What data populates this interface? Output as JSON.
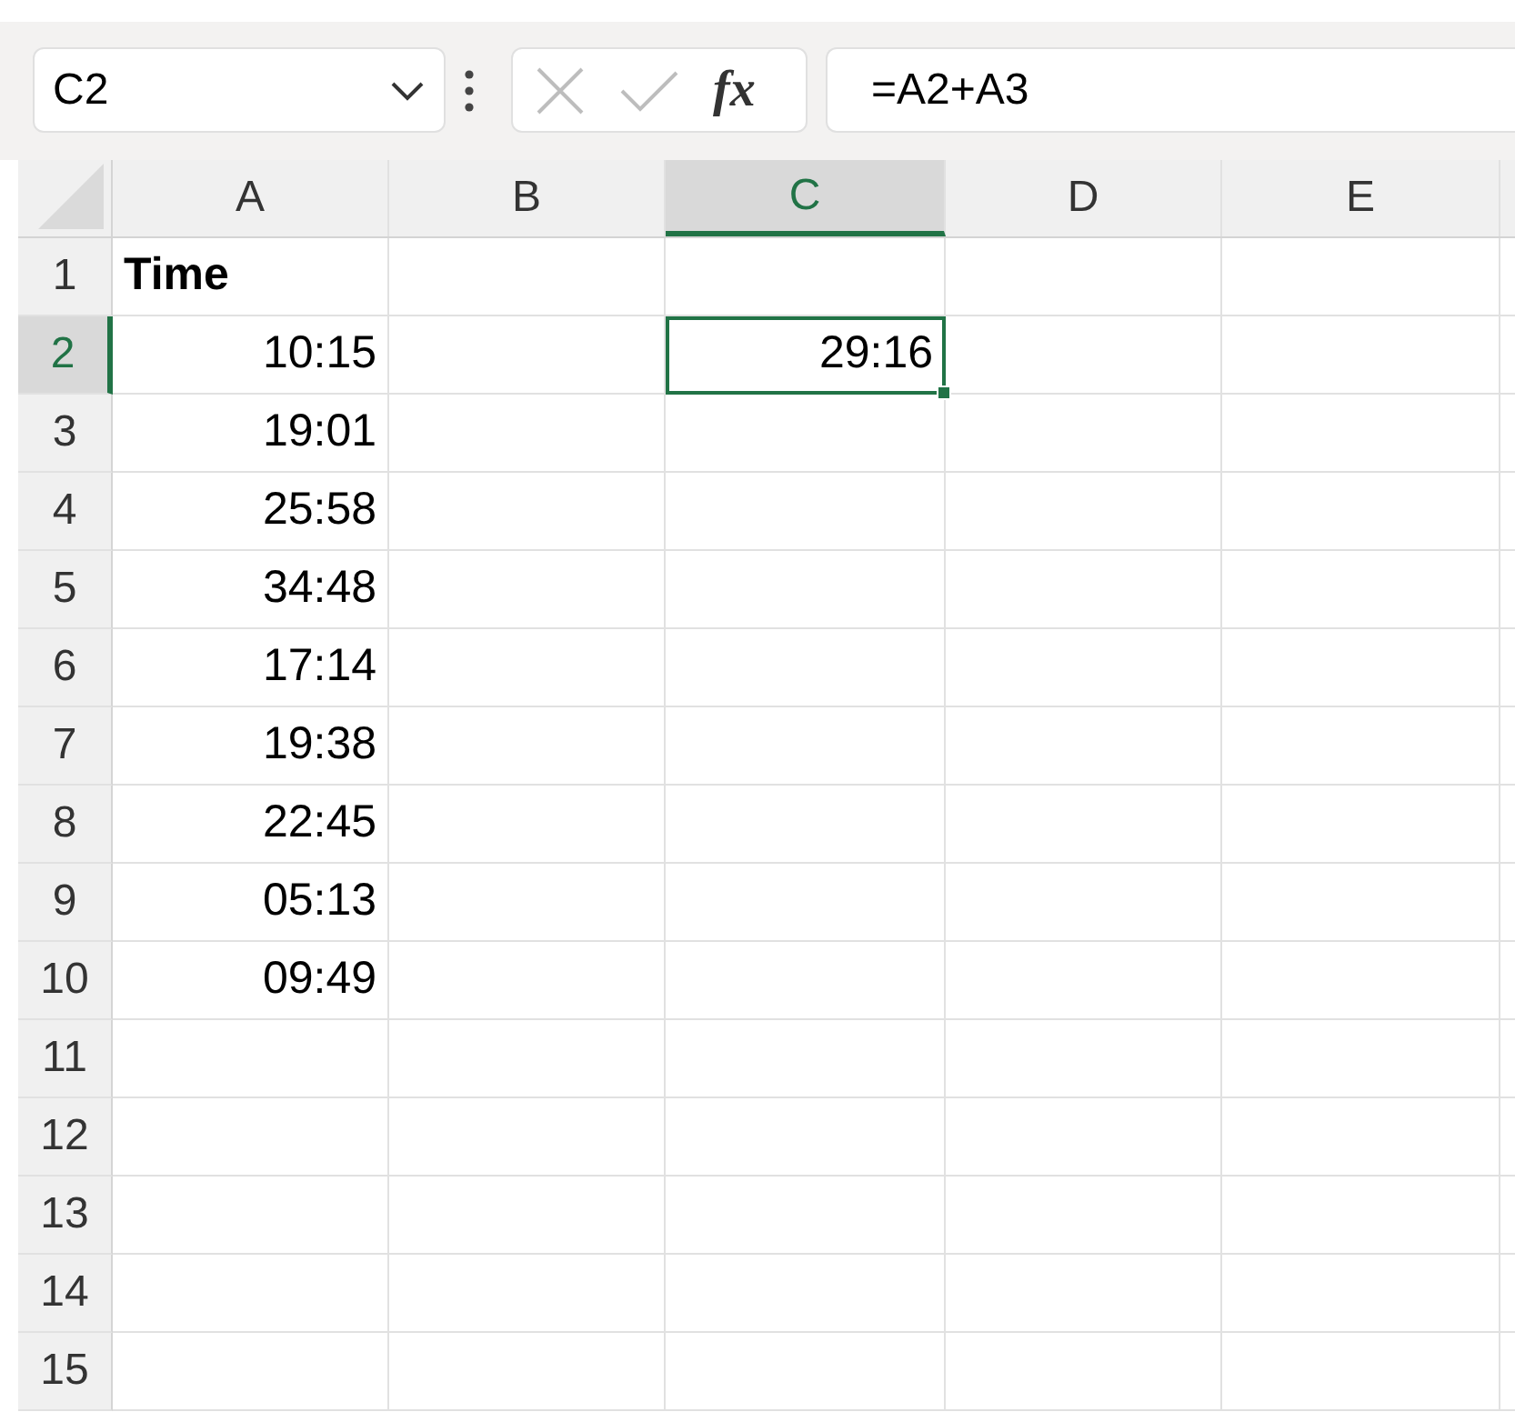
{
  "name_box": {
    "value": "C2"
  },
  "formula_bar": {
    "function_label": "fx",
    "value": "=A2+A3"
  },
  "columns": [
    {
      "label": "A",
      "selected": false
    },
    {
      "label": "B",
      "selected": false
    },
    {
      "label": "C",
      "selected": true
    },
    {
      "label": "D",
      "selected": false
    },
    {
      "label": "E",
      "selected": false
    }
  ],
  "rows": [
    {
      "label": "1",
      "selected": false,
      "cells": [
        {
          "text": "Time",
          "kind": "header",
          "selected": false
        }
      ]
    },
    {
      "label": "2",
      "selected": true,
      "cells": [
        {
          "text": "10:15",
          "kind": "time",
          "selected": false
        },
        null,
        {
          "text": "29:16",
          "kind": "time",
          "selected": true
        }
      ]
    },
    {
      "label": "3",
      "selected": false,
      "cells": [
        {
          "text": "19:01",
          "kind": "time",
          "selected": false
        }
      ]
    },
    {
      "label": "4",
      "selected": false,
      "cells": [
        {
          "text": "25:58",
          "kind": "time",
          "selected": false
        }
      ]
    },
    {
      "label": "5",
      "selected": false,
      "cells": [
        {
          "text": "34:48",
          "kind": "time",
          "selected": false
        }
      ]
    },
    {
      "label": "6",
      "selected": false,
      "cells": [
        {
          "text": "17:14",
          "kind": "time",
          "selected": false
        }
      ]
    },
    {
      "label": "7",
      "selected": false,
      "cells": [
        {
          "text": "19:38",
          "kind": "time",
          "selected": false
        }
      ]
    },
    {
      "label": "8",
      "selected": false,
      "cells": [
        {
          "text": "22:45",
          "kind": "time",
          "selected": false
        }
      ]
    },
    {
      "label": "9",
      "selected": false,
      "cells": [
        {
          "text": "05:13",
          "kind": "time",
          "selected": false
        }
      ]
    },
    {
      "label": "10",
      "selected": false,
      "cells": [
        {
          "text": "09:49",
          "kind": "time",
          "selected": false
        }
      ]
    },
    {
      "label": "11",
      "selected": false
    },
    {
      "label": "12",
      "selected": false
    },
    {
      "label": "13",
      "selected": false
    },
    {
      "label": "14",
      "selected": false
    },
    {
      "label": "15",
      "selected": false
    }
  ]
}
